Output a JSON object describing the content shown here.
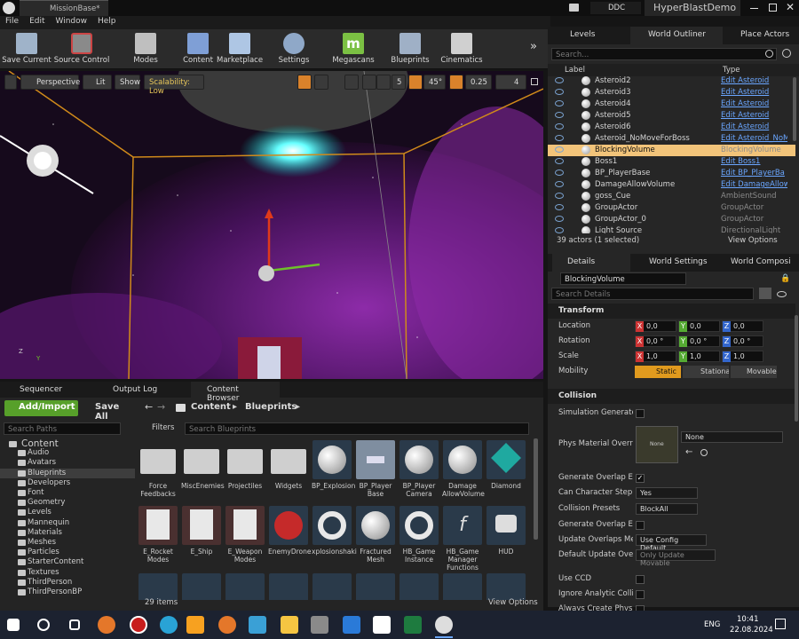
{
  "window": {
    "tab": "MissionBase*",
    "ddc": "DDC",
    "project": "HyperBlastDemo"
  },
  "menu": [
    "File",
    "Edit",
    "Window",
    "Help"
  ],
  "toolbar": {
    "save_current": "Save Current",
    "source_control": "Source Control",
    "modes": "Modes",
    "content": "Content",
    "marketplace": "Marketplace",
    "settings": "Settings",
    "megascans": "Megascans",
    "blueprints": "Blueprints",
    "cinematics": "Cinematics"
  },
  "viewport": {
    "perspective": "Perspective",
    "lit": "Lit",
    "show": "Show",
    "scalability": "Scalability: Low",
    "grid_snap": "5",
    "angle_snap": "45°",
    "scale_snap": "0.25",
    "camera_speed": "4",
    "axis_z": "Z",
    "axis_y": "Y"
  },
  "outliner": {
    "tabs": [
      "Levels",
      "World Outliner",
      "Place Actors"
    ],
    "search_placeholder": "Search...",
    "col_label": "Label",
    "col_type": "Type",
    "rows": [
      {
        "label": "Asteroid2",
        "type": "Edit Asteroid",
        "link": true
      },
      {
        "label": "Asteroid3",
        "type": "Edit Asteroid",
        "link": true
      },
      {
        "label": "Asteroid4",
        "type": "Edit Asteroid",
        "link": true
      },
      {
        "label": "Asteroid5",
        "type": "Edit Asteroid",
        "link": true
      },
      {
        "label": "Asteroid6",
        "type": "Edit Asteroid",
        "link": true
      },
      {
        "label": "Asteroid_NoMoveForBoss",
        "type": "Edit Asteroid_NoM",
        "link": true
      },
      {
        "label": "BlockingVolume",
        "type": "BlockingVolume",
        "link": false,
        "selected": true
      },
      {
        "label": "Boss1",
        "type": "Edit Boss1",
        "link": true
      },
      {
        "label": "BP_PlayerBase",
        "type": "Edit BP_PlayerBa",
        "link": true
      },
      {
        "label": "DamageAllowVolume",
        "type": "Edit DamageAllow",
        "link": true
      },
      {
        "label": "goss_Cue",
        "type": "AmbientSound",
        "link": false
      },
      {
        "label": "GroupActor",
        "type": "GroupActor",
        "link": false
      },
      {
        "label": "GroupActor_0",
        "type": "GroupActor",
        "link": false
      },
      {
        "label": "Light Source",
        "type": "DirectionalLight",
        "link": false
      }
    ],
    "status": "39 actors (1 selected)",
    "view_options": "View Options"
  },
  "details": {
    "tabs": [
      "Details",
      "World Settings",
      "World Composi"
    ],
    "name": "BlockingVolume",
    "search_placeholder": "Search Details",
    "transform": "Transform",
    "location": "Location",
    "rotation": "Rotation",
    "scale": "Scale",
    "mobility": "Mobility",
    "loc": [
      "0,0",
      "0,0",
      "0,0"
    ],
    "rot": [
      "0,0 °",
      "0,0 °",
      "0,0 °"
    ],
    "scl": [
      "1,0",
      "1,0",
      "1,0"
    ],
    "mob": [
      "Static",
      "Stationary",
      "Movable"
    ],
    "collision": "Collision",
    "sim_hit": "Simulation Generates H",
    "phys_mat": "Phys Material Override",
    "phys_none": "None",
    "phys_dd": "None",
    "gen_overlap": "Generate Overlap Event",
    "step_up": "Can Character Step Up",
    "step_up_val": "Yes",
    "presets": "Collision Presets",
    "presets_val": "BlockAll",
    "gen_overlap2": "Generate Overlap Event",
    "update_method": "Update Overlaps Metho",
    "update_method_val": "Use Config Default",
    "default_update": "Default Update Overlap",
    "default_update_val": "Only Update Movable",
    "use_ccd": "Use CCD",
    "ignore_analytic": "Ignore Analytic Collisio",
    "always_create": "Always Create Physics"
  },
  "bottom": {
    "tabs": [
      "Sequencer",
      "Output Log",
      "Content Browser"
    ],
    "add_import": "Add/Import",
    "save_all": "Save All",
    "path_content": "Content",
    "path_blueprints": "Blueprints",
    "search_paths": "Search Paths",
    "filters": "Filters",
    "search_bp": "Search Blueprints",
    "tree": [
      "Content",
      "Audio",
      "Avatars",
      "Blueprints",
      "Developers",
      "Font",
      "Geometry",
      "Levels",
      "Mannequin",
      "Materials",
      "Meshes",
      "Particles",
      "StarterContent",
      "Textures",
      "ThirdPerson",
      "ThirdPersonBP"
    ],
    "tiles_row1": [
      "Force Feedbacks",
      "MiscEnemies",
      "Projectiles",
      "Widgets",
      "BP_Explosion",
      "BP_Player Base",
      "BP_Player Camera",
      "Damage AllowVolume",
      "Diamond"
    ],
    "tiles_row2": [
      "E_Rocket Modes",
      "E_Ship",
      "E_Weapon Modes",
      "EnemyDrone",
      "xplosionshaki",
      "Fractured Mesh",
      "HB_Game Instance",
      "HB_Game Manager Functions",
      "HUD"
    ],
    "items": "29 items",
    "view_options": "View Options"
  },
  "taskbar": {
    "lang": "ENG",
    "time": "10:41",
    "date": "22.08.2024"
  }
}
